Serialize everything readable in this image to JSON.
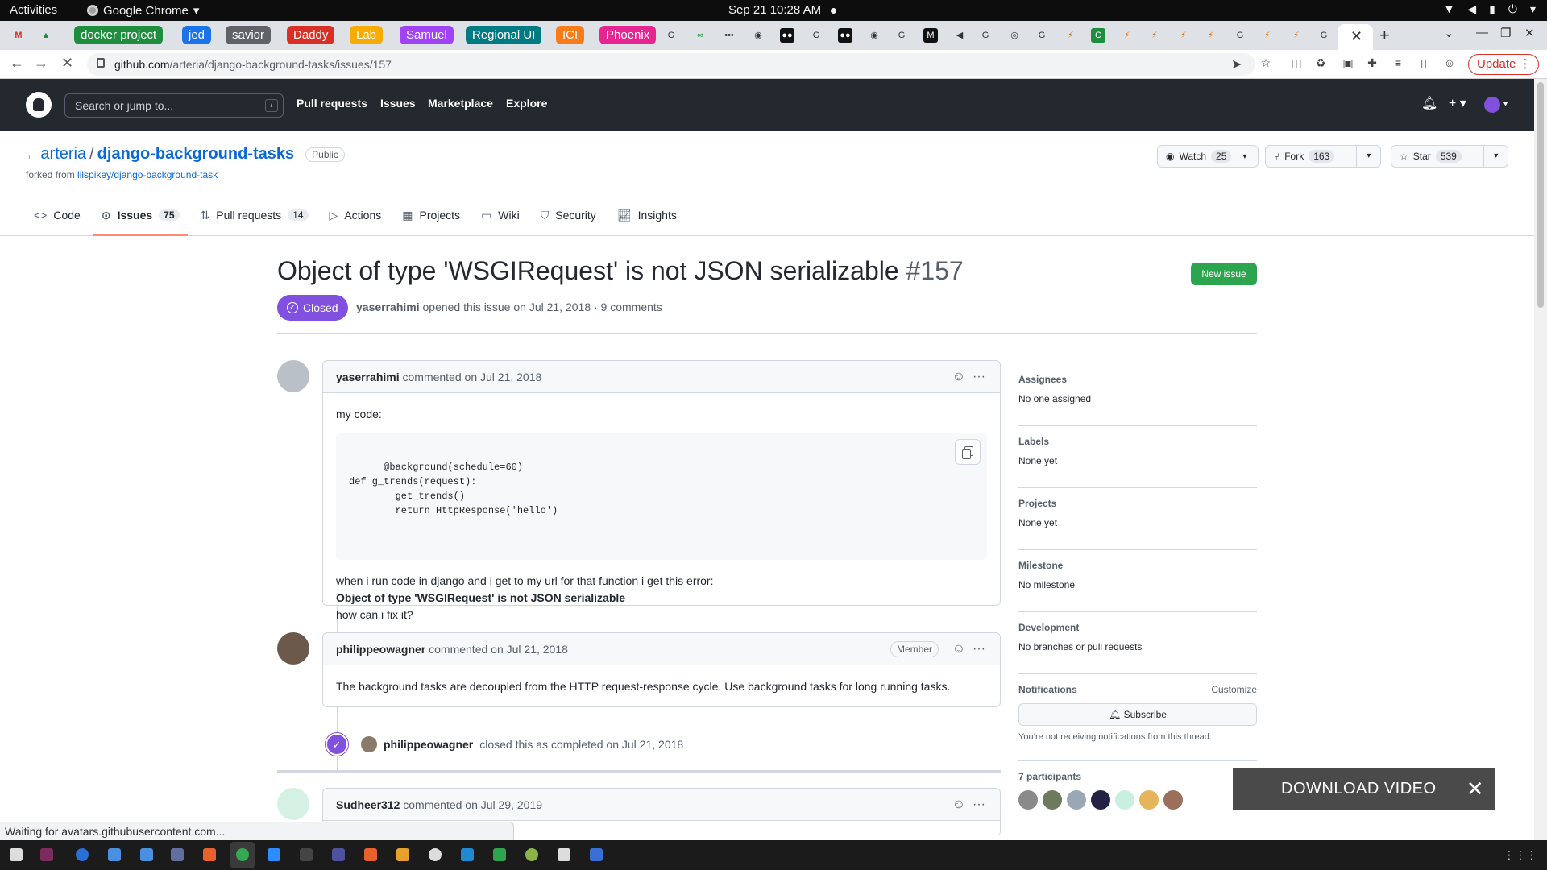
{
  "os": {
    "activities": "Activities",
    "app_name": "Google Chrome",
    "clock": "Sep 21  10:28 AM"
  },
  "tab_groups": [
    {
      "label": "docker project",
      "color": "#1e8e3e"
    },
    {
      "label": "jed",
      "color": "#1a73e8"
    },
    {
      "label": "savior",
      "color": "#5f6368"
    },
    {
      "label": "Daddy",
      "color": "#d93025"
    },
    {
      "label": "Lab",
      "color": "#f9ab00"
    },
    {
      "label": "Samuel",
      "color": "#a142f4"
    },
    {
      "label": "Regional UI",
      "color": "#007b83"
    },
    {
      "label": "ICI",
      "color": "#fa7b17"
    },
    {
      "label": "Phoenix",
      "color": "#e52592"
    }
  ],
  "address_bar": {
    "domain": "github.com",
    "path": "/arteria/django-background-tasks/issues/157",
    "update_label": "Update"
  },
  "gh_header": {
    "search_placeholder": "Search or jump to...",
    "search_key": "/",
    "nav": [
      "Pull requests",
      "Issues",
      "Marketplace",
      "Explore"
    ]
  },
  "repo": {
    "owner": "arteria",
    "separator": "/",
    "name": "django-background-tasks",
    "visibility": "Public",
    "forked_prefix": "forked from ",
    "forked_from": "lilspikey/django-background-task",
    "watch_label": "Watch",
    "watch_count": "25",
    "fork_label": "Fork",
    "fork_count": "163",
    "star_label": "Star",
    "star_count": "539",
    "tabs": [
      {
        "label": "Code",
        "count": "",
        "icon": "code-icon"
      },
      {
        "label": "Issues",
        "count": "75",
        "icon": "issue-icon"
      },
      {
        "label": "Pull requests",
        "count": "14",
        "icon": "pr-icon"
      },
      {
        "label": "Actions",
        "count": "",
        "icon": "play-icon"
      },
      {
        "label": "Projects",
        "count": "",
        "icon": "table-icon"
      },
      {
        "label": "Wiki",
        "count": "",
        "icon": "book-icon"
      },
      {
        "label": "Security",
        "count": "",
        "icon": "shield-icon"
      },
      {
        "label": "Insights",
        "count": "",
        "icon": "graph-icon"
      }
    ]
  },
  "issue": {
    "title": "Object of type 'WSGIRequest' is not JSON serializable",
    "number": "#157",
    "new_issue_label": "New issue",
    "state": "Closed",
    "author": "yaserrahimi",
    "meta_text": "opened this issue on Jul 21, 2018 · 9 comments"
  },
  "comments": [
    {
      "author": "yaserrahimi",
      "action": "commented on Jul 21, 2018",
      "intro": "my code:",
      "code": "@background(schedule=60)\ndef g_trends(request):\n        get_trends()\n        return HttpResponse('hello')",
      "line1": "when i run code in django and i get to my url for that function i get this error:",
      "bold_line": "Object of type 'WSGIRequest' is not JSON serializable",
      "line3": "how can i fix it?"
    },
    {
      "author": "philippeowagner",
      "action": "commented on Jul 21, 2018",
      "role": "Member",
      "body": "The background tasks are decoupled from the HTTP request-response cycle. Use background tasks for long running tasks."
    },
    {
      "author": "Sudheer312",
      "action": "commented on Jul 29, 2019"
    }
  ],
  "close_event": {
    "actor": "philippeowagner",
    "text": "closed this as completed on Jul 21, 2018"
  },
  "sidebar": {
    "assignees_h": "Assignees",
    "assignees_v": "No one assigned",
    "labels_h": "Labels",
    "labels_v": "None yet",
    "projects_h": "Projects",
    "projects_v": "None yet",
    "milestone_h": "Milestone",
    "milestone_v": "No milestone",
    "development_h": "Development",
    "development_v": "No branches or pull requests",
    "notifications_h": "Notifications",
    "customize": "Customize",
    "subscribe": "Subscribe",
    "notify_note": "You’re not receiving notifications from this thread.",
    "participants_h": "7 participants"
  },
  "overlay": {
    "download_video": "DOWNLOAD VIDEO",
    "status": "Waiting for avatars.githubusercontent.com..."
  }
}
